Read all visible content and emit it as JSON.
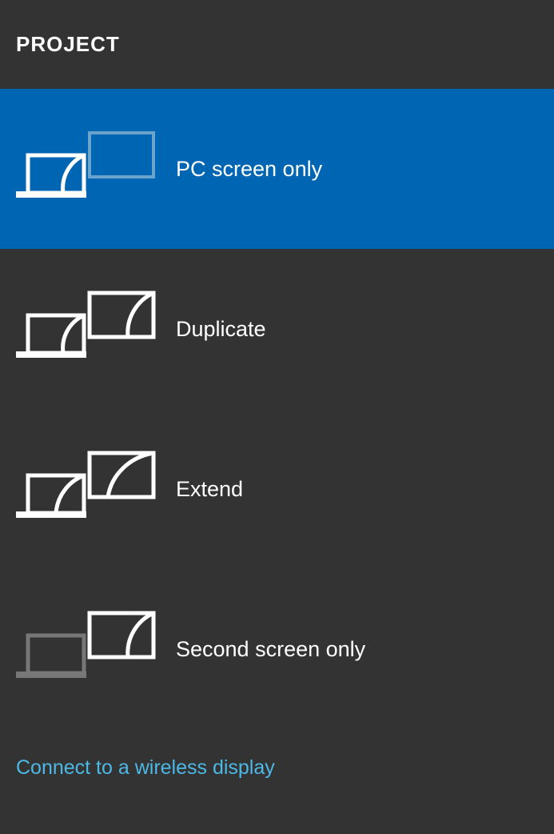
{
  "header": {
    "title": "PROJECT"
  },
  "options": [
    {
      "label": "PC screen only"
    },
    {
      "label": "Duplicate"
    },
    {
      "label": "Extend"
    },
    {
      "label": "Second screen only"
    }
  ],
  "footer": {
    "connect_label": "Connect to a wireless display"
  },
  "selected_index": 0
}
